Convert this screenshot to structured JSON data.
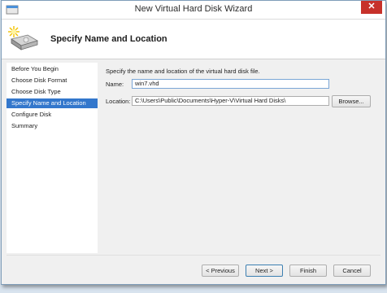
{
  "window": {
    "title": "New Virtual Hard Disk Wizard",
    "close_label": "✕"
  },
  "header": {
    "title": "Specify Name and Location",
    "icon": "disk-wizard-icon"
  },
  "sidebar": {
    "items": [
      {
        "label": "Before You Begin",
        "active": false
      },
      {
        "label": "Choose Disk Format",
        "active": false
      },
      {
        "label": "Choose Disk Type",
        "active": false
      },
      {
        "label": "Specify Name and Location",
        "active": true
      },
      {
        "label": "Configure Disk",
        "active": false
      },
      {
        "label": "Summary",
        "active": false
      }
    ]
  },
  "main": {
    "description": "Specify the name and location of the virtual hard disk file.",
    "name_label": "Name:",
    "name_value": "win7.vhd",
    "location_label": "Location:",
    "location_value": "C:\\Users\\Public\\Documents\\Hyper-V\\Virtual Hard Disks\\",
    "browse_label": "Browse..."
  },
  "footer": {
    "previous_label": "< Previous",
    "next_label": "Next >",
    "finish_label": "Finish",
    "cancel_label": "Cancel"
  },
  "colors": {
    "accent": "#3377cc",
    "close": "#c7312a"
  }
}
